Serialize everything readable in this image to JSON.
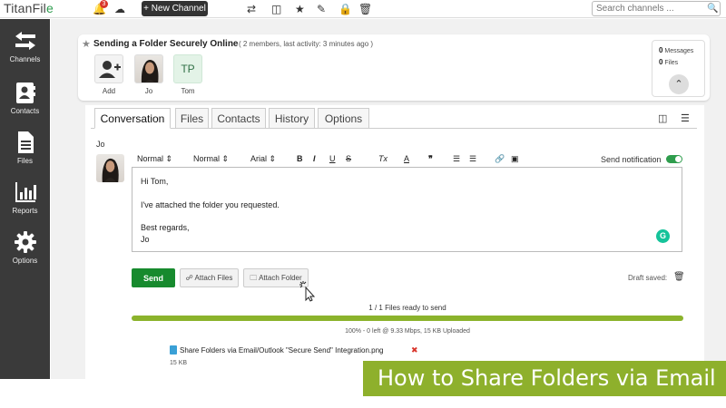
{
  "app": {
    "logo_main": "TitanFil",
    "logo_accent": "e",
    "notification_count": "3",
    "new_channel_label": "+ New Channel",
    "search_placeholder": "Search channels ..."
  },
  "sidebar": {
    "items": [
      {
        "label": "Channels",
        "icon": "arrows-icon"
      },
      {
        "label": "Contacts",
        "icon": "contacts-icon"
      },
      {
        "label": "Files",
        "icon": "file-icon"
      },
      {
        "label": "Reports",
        "icon": "chart-icon"
      },
      {
        "label": "Options",
        "icon": "gear-icon"
      }
    ]
  },
  "channel": {
    "title": "Sending a Folder Securely Online",
    "meta": "( 2 members, last activity: 3 minutes ago )",
    "members": [
      {
        "label": "Add"
      },
      {
        "label": "Jo"
      },
      {
        "initials": "TP",
        "label": "Tom"
      }
    ],
    "messages_count": "0",
    "messages_label": "Messages",
    "files_count": "0",
    "files_label": "Files"
  },
  "tabs": [
    {
      "label": "Conversation",
      "active": true
    },
    {
      "label": "Files"
    },
    {
      "label": "Contacts"
    },
    {
      "label": "History"
    },
    {
      "label": "Options"
    }
  ],
  "composer": {
    "from": "Jo",
    "toolbar": {
      "format": "Normal",
      "size": "Normal",
      "font": "Arial",
      "bold": "B",
      "italic": "I",
      "underline": "U",
      "strike": "S",
      "clear": "Tx",
      "color": "A",
      "quote": "❞"
    },
    "send_notification_label": "Send notification",
    "message_lines": [
      "Hi Tom,",
      "I've attached the folder you requested.",
      "Best regards,",
      "Jo"
    ],
    "send_label": "Send",
    "attach_files_label": "Attach Files",
    "attach_folder_label": "Attach Folder",
    "draft_status": "Draft saved:"
  },
  "upload": {
    "ready_text": "1 / 1 Files ready to send",
    "progress_percent": 100,
    "info_text": "100% - 0 left @ 9.33 Mbps, 15 KB Uploaded",
    "file_name": "Share Folders via Email/Outlook \"Secure Send\" Integration.png",
    "file_size": "15 KB"
  },
  "banner": {
    "text": "How to Share Folders via Email"
  },
  "colors": {
    "sidebar_bg": "#3a3a3a",
    "send_button": "#178a2e",
    "progress_fill": "#8bb32c",
    "banner_bg": "#8eb02c"
  }
}
